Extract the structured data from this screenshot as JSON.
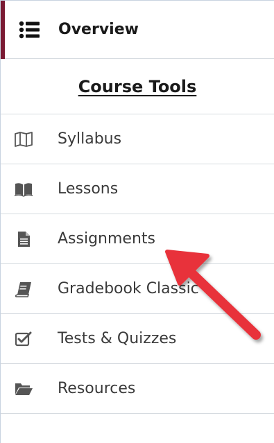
{
  "overview": {
    "label": "Overview",
    "icon": "list-icon",
    "accent_color": "#7a1a33"
  },
  "course_tools": {
    "title": "Course Tools"
  },
  "nav_items": [
    {
      "label": "Syllabus",
      "icon": "map-icon"
    },
    {
      "label": "Lessons",
      "icon": "book-open-icon"
    },
    {
      "label": "Assignments",
      "icon": "document-icon"
    },
    {
      "label": "Gradebook Classic",
      "icon": "book-icon"
    },
    {
      "label": "Tests & Quizzes",
      "icon": "checkbox-icon"
    },
    {
      "label": "Resources",
      "icon": "folder-open-icon"
    }
  ],
  "annotation": {
    "arrow_color": "#e8333a"
  }
}
